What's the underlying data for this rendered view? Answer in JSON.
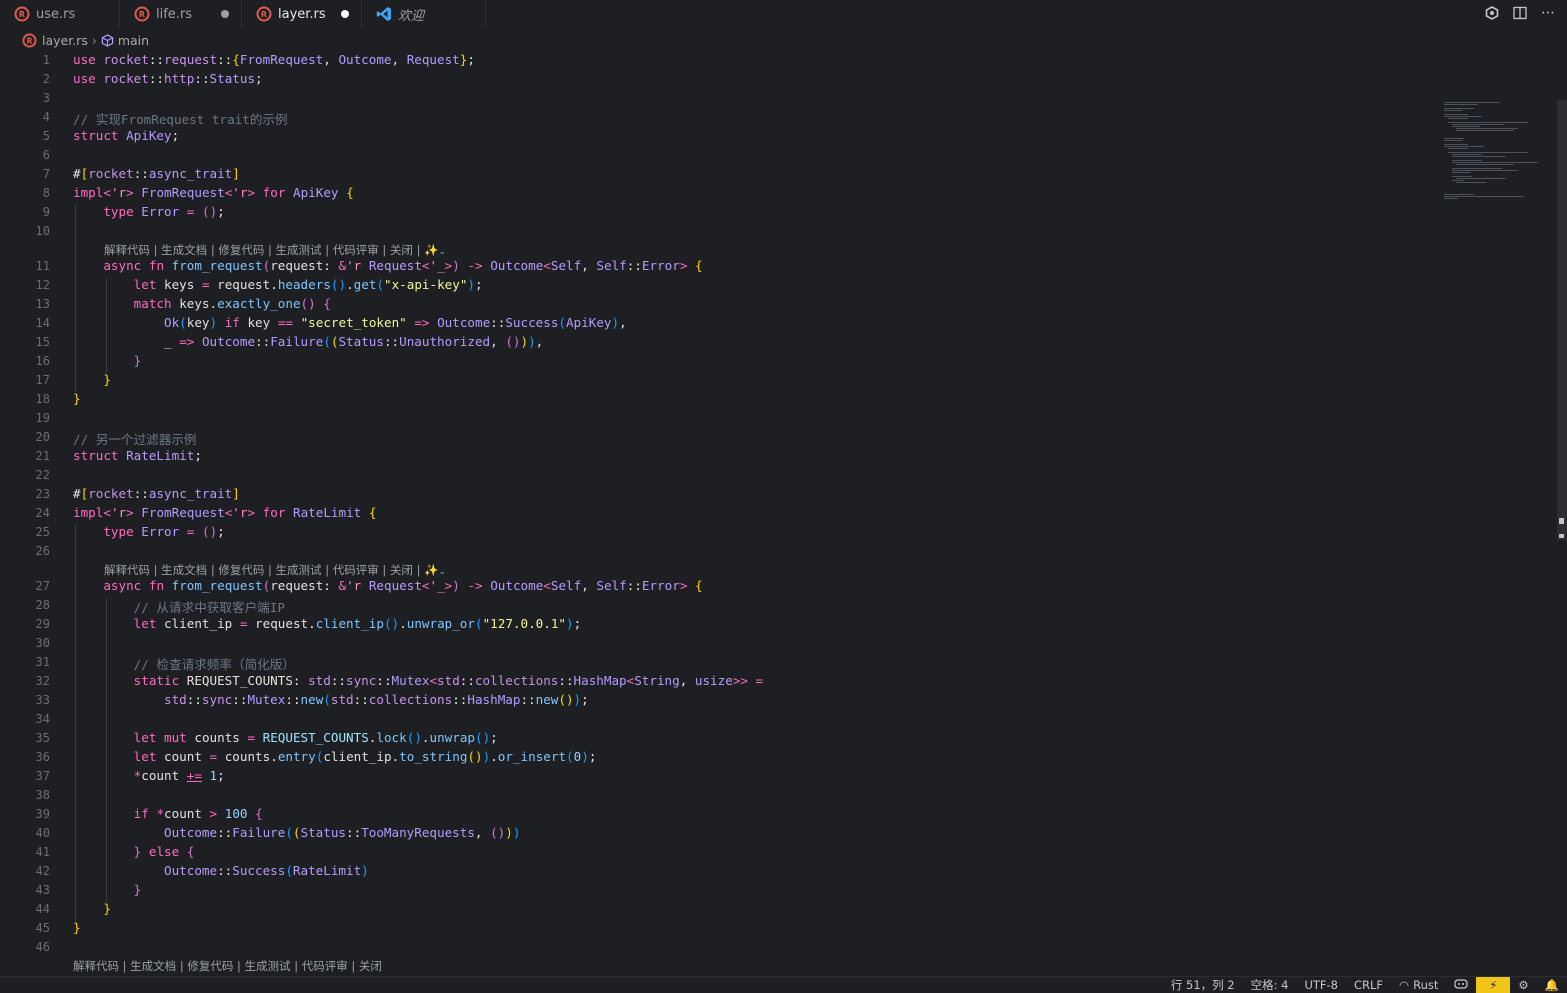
{
  "tabs": [
    {
      "label": "use.rs",
      "icon": "rust-icon",
      "dirty": false,
      "active": false
    },
    {
      "label": "life.rs",
      "icon": "rust-icon",
      "dirty": true,
      "active": false
    },
    {
      "label": "layer.rs",
      "icon": "rust-icon",
      "dirty": true,
      "active": true
    },
    {
      "label": "欢迎",
      "icon": "vscode-icon",
      "dirty": false,
      "active": false
    }
  ],
  "breadcrumb": {
    "file": "layer.rs",
    "symbol": "main"
  },
  "codelens": "解释代码 | 生成文档 | 修复代码 | 生成测试 | 代码评审 | 关闭 | ",
  "codelens_bottom": "解释代码 | 生成文档 | 修复代码 | 生成测试 | 代码评审 | 关闭",
  "status": {
    "position": "行 51，列 2",
    "spaces": "空格: 4",
    "encoding": "UTF-8",
    "eol": "CRLF",
    "language": "Rust"
  },
  "colors": {
    "background": "#1e1f22",
    "warning": "#f0c419"
  }
}
